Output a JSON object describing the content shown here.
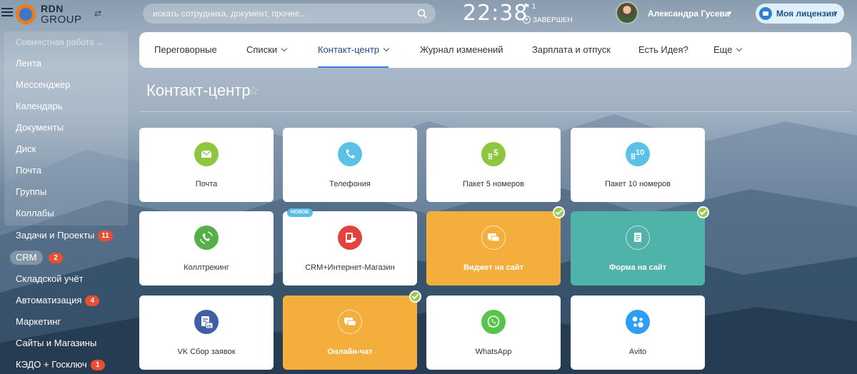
{
  "header": {
    "logo_line1": "RDN",
    "logo_line2": "GROUP",
    "search_placeholder": "искать сотрудника, документ, прочее...",
    "time": "22:38",
    "flag_count": "1",
    "status": "ЗАВЕРШЕН",
    "user_name": "Александра Гусева",
    "license_label": "Моя лицензия"
  },
  "sidebar": {
    "group_label": "Совместная работа",
    "items": [
      {
        "label": "Лента"
      },
      {
        "label": "Мессенджер"
      },
      {
        "label": "Календарь"
      },
      {
        "label": "Документы"
      },
      {
        "label": "Диск"
      },
      {
        "label": "Почта"
      },
      {
        "label": "Группы"
      },
      {
        "label": "Коллабы"
      },
      {
        "label": "Задачи и Проекты",
        "badge": "11"
      },
      {
        "label": "CRM",
        "badge": "2"
      },
      {
        "label": "Складской учёт"
      },
      {
        "label": "Автоматизация",
        "badge": "4"
      },
      {
        "label": "Маркетинг"
      },
      {
        "label": "Сайты и Магазины"
      },
      {
        "label": "КЭДО + Госключ",
        "badge": "1"
      }
    ]
  },
  "nav": {
    "items": [
      {
        "label": "Переговорные"
      },
      {
        "label": "Списки"
      },
      {
        "label": "Контакт-центр"
      },
      {
        "label": "Журнал изменений"
      },
      {
        "label": "Зарплата и отпуск"
      },
      {
        "label": "Есть Идея?"
      },
      {
        "label": "Еще"
      }
    ]
  },
  "page": {
    "title": "Контакт-центр"
  },
  "tiles": [
    {
      "label": "Почта",
      "icon": "mail-icon",
      "color": "#8dc63f"
    },
    {
      "label": "Телефония",
      "icon": "phone-icon",
      "color": "#5bc2e7"
    },
    {
      "label": "Пакет 5 номеров",
      "icon": "package-5-icon",
      "icon_text": "5",
      "color": "#8dc63f"
    },
    {
      "label": "Пакет 10 номеров",
      "icon": "package-10-icon",
      "icon_text": "10",
      "color": "#5bc2e7"
    },
    {
      "label": "Коллтрекинг",
      "icon": "calltracking-icon",
      "color": "#55b047"
    },
    {
      "label": "CRM+Интернет-Магазин",
      "icon": "shop-icon",
      "color": "#e4423f",
      "badge": "НОВОЕ"
    },
    {
      "label": "Виджет на сайт",
      "icon": "chat-icon",
      "color": "#f4ae3c"
    },
    {
      "label": "Форма на сайт",
      "icon": "form-icon",
      "color": "#4fb3a9"
    },
    {
      "label": "VK Сбор заявок",
      "icon": "vk-form-icon",
      "color": "#3e5fa6"
    },
    {
      "label": "Онлайн-чат",
      "icon": "chat-icon",
      "color": "#f4ae3c"
    },
    {
      "label": "WhatsApp",
      "icon": "whatsapp-icon",
      "color": "#58c44c"
    },
    {
      "label": "Avito",
      "icon": "avito-icon",
      "color": "#2e9ef5"
    }
  ]
}
